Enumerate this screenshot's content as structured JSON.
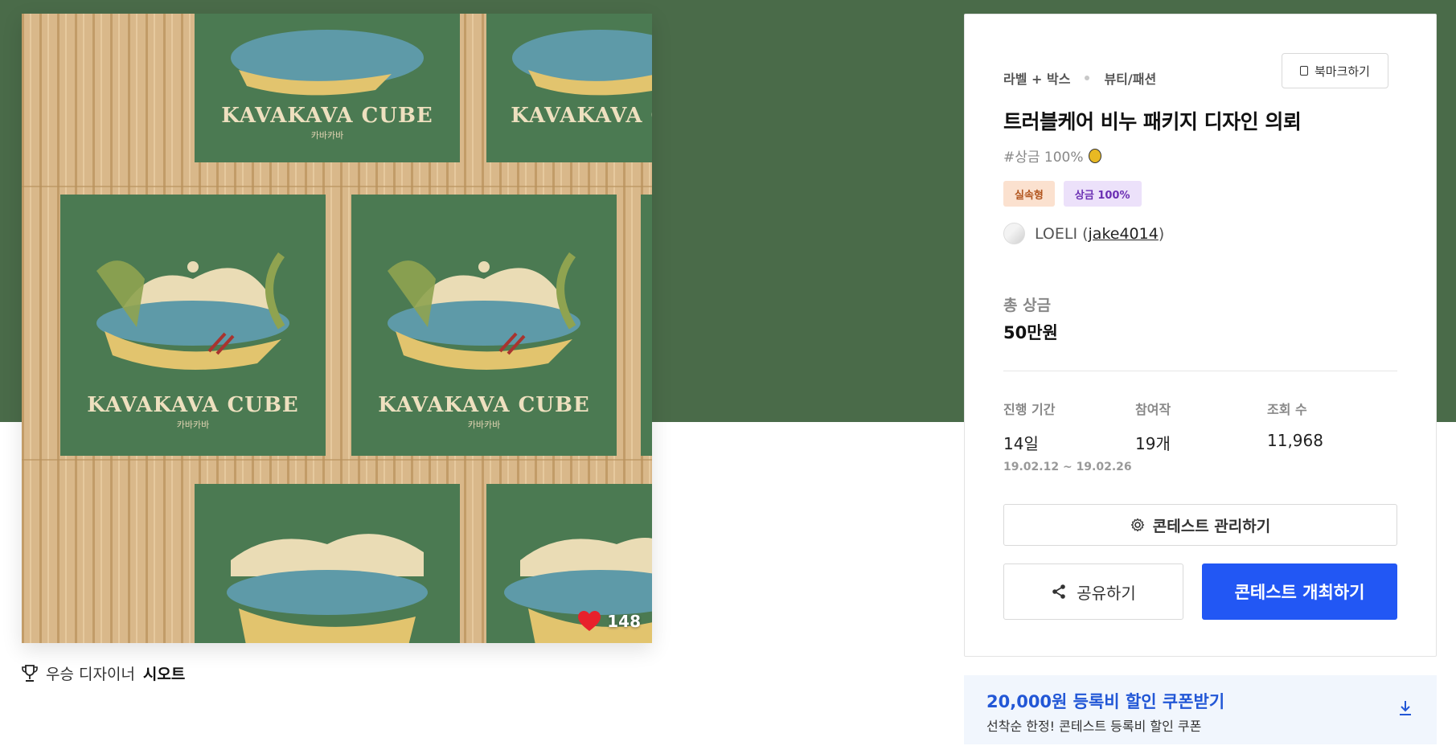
{
  "artwork": {
    "brand_text": "KAVAKAVA CUBE",
    "sub_text": "카바카바",
    "likes": "148"
  },
  "winner": {
    "prefix": "우승 디자이너",
    "name": "시오트"
  },
  "card": {
    "bookmark_label": "북마크하기",
    "category_primary": "라벨 + 박스",
    "category_secondary": "뷰티/패션",
    "title": "트러블케어 비누 패키지 디자인 의뢰",
    "hashtag": "#상금 100%",
    "badges": [
      "실속형",
      "상금 100%"
    ],
    "owner_name": "LOELI",
    "owner_id": "jake4014",
    "prize_label": "총 상금",
    "prize_value": "50만원",
    "stats": {
      "period_label": "진행 기간",
      "period_value": "14일",
      "period_range": "19.02.12 ~ 19.02.26",
      "entries_label": "참여작",
      "entries_value": "19개",
      "views_label": "조회 수",
      "views_value": "11,968"
    },
    "manage_label": "콘테스트 관리하기",
    "share_label": "공유하기",
    "host_label": "콘테스트 개최하기"
  },
  "coupon": {
    "title": "20,000원 등록비 할인 쿠폰받기",
    "subtitle": "선착순 한정! 콘테스트 등록비 할인 쿠폰"
  },
  "colors": {
    "hero_bg": "#4a6b49",
    "primary": "#2257f4",
    "coupon_bg": "#f1f6fd",
    "badge_orange_bg": "#fbe1cf",
    "badge_purple_bg": "#ece1fa",
    "heart": "#e8212b"
  },
  "icons": [
    "trophy-icon",
    "heart-icon",
    "bookmark-icon",
    "gear-icon",
    "share-icon",
    "download-icon",
    "medal-icon"
  ]
}
